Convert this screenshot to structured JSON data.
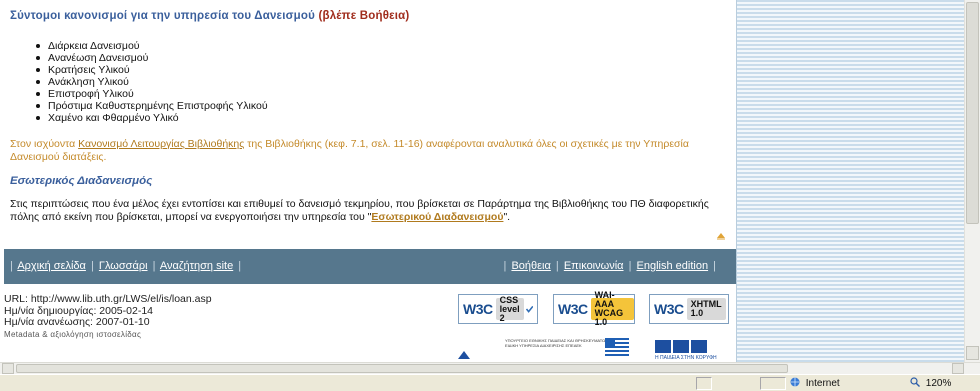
{
  "content": {
    "heading": "Σύντομοι κανονισμοί για την υπηρεσία του Δανεισμού",
    "heading_help": "(βλέπε Βοήθεια)",
    "list_items": [
      "Διάρκεια Δανεισμού",
      "Ανανέωση Δανεισμού",
      "Κρατήσεις Υλικού",
      "Ανάκληση Υλικού",
      "Επιστροφή Υλικού",
      "Πρόστιμα Καθυστερημένης Επιστροφής Υλικού",
      "Χαμένο και Φθαρμένο Υλικό"
    ],
    "regulation_para": {
      "before": "Στον ισχύοντα ",
      "link": "Κανονισμό Λειτουργίας Βιβλιοθήκης",
      "after": " της Βιβλιοθήκης (κεφ. 7.1, σελ. 11-16) αναφέρονται αναλυτικά όλες οι σχετικές με την Υπηρεσία Δανεισμού διατάξεις."
    },
    "subheading": "Εσωτερικός Διαδανεισμός",
    "ill_para": {
      "before": "Στις περιπτώσεις που ένα μέλος έχει εντοπίσει και επιθυμεί το δανεισμό τεκμηρίου, που βρίσκεται σε Παράρτημα της Βιβλιοθήκης του ΠΘ διαφορετικής πόλης από εκείνη που βρίσκεται, μπορεί να ενεργοποιήσει την υπηρεσία του \"",
      "link": "Εσωτερικού Διαδανεισμού",
      "after": "\"."
    }
  },
  "footer_nav": {
    "left": [
      "Αρχική σελίδα",
      "Γλωσσάρι",
      "Αναζήτηση site"
    ],
    "right": [
      "Βοήθεια",
      "Επικοινωνία",
      "English edition"
    ],
    "separator": "|"
  },
  "meta": {
    "url": "URL: http://www.lib.uth.gr/LWS/el/is/loan.asp",
    "created": "Ημ/νία δημιουργίας: 2005-02-14",
    "updated": "Ημ/νία ανανέωσης: 2007-01-10",
    "metadata_link": "Metadata & αξιολόγηση ιστοσελίδας"
  },
  "badges": {
    "w3c": "W3C",
    "css": [
      "CSS",
      "level 2"
    ],
    "wai": [
      "WAI-AAA",
      "WCAG 1.0"
    ],
    "xhtml": [
      "XHTML",
      "1.0"
    ]
  },
  "sponsors": {
    "ministry_text": [
      "ΥΠΟΥΡΓΕΙΟ ΕΘΝΙΚΗΣ ΠΑΙΔΕΙΑΣ ΚΑΙ ΘΡΗΣΚΕΥΜΑΤΩΝ",
      "ΕΙΔΙΚΗ ΥΠΗΡΕΣΙΑ ΔΙΑΧΕΙΡΙΣΗΣ ΕΠΕΑΕΚ"
    ],
    "eu_text": "Η ΠΑΙΔΕΙΑ ΣΤΗΝ ΚΟΡΥΦΗ"
  },
  "statusbar": {
    "zone": "Internet",
    "zoom": "120%"
  },
  "colors": {
    "heading_blue": "#3a5f9c",
    "help_red": "#a02c1c",
    "orange_text": "#c48a2a",
    "footer_bar": "#56778d",
    "side_stripe": "#c9dceb"
  }
}
